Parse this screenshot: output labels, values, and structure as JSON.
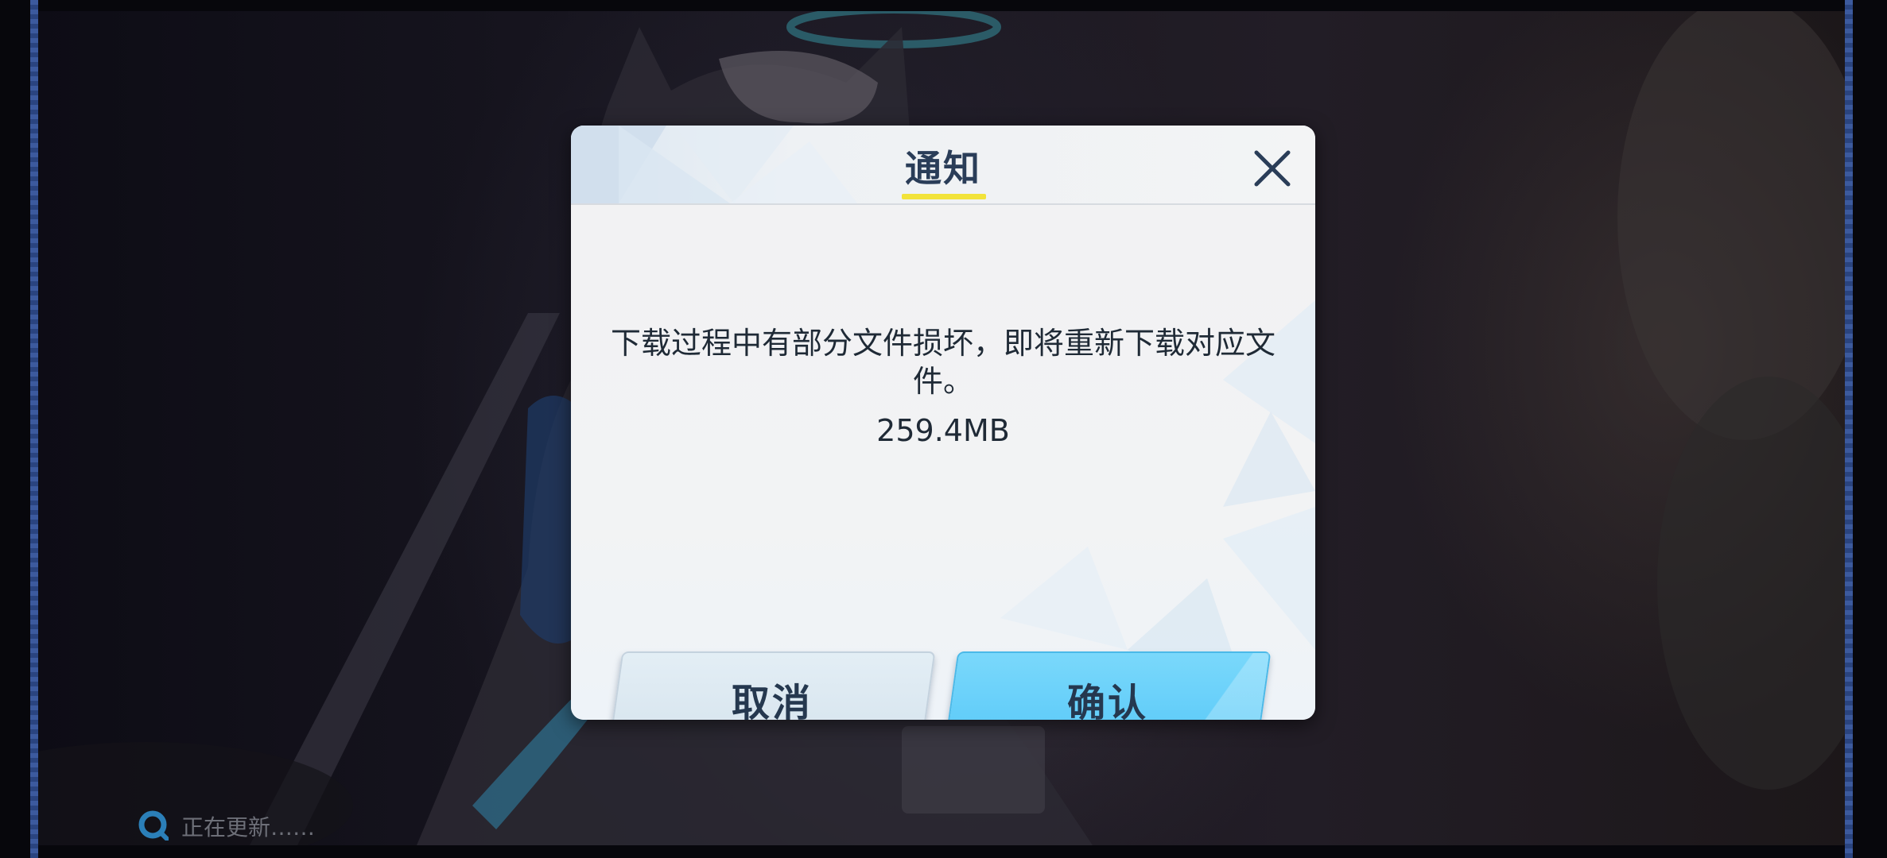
{
  "dialog": {
    "title": "通知",
    "message": "下载过程中有部分文件损坏，即将重新下载对应文件。",
    "size": "259.4MB",
    "cancel_label": "取消",
    "confirm_label": "确认"
  },
  "status": {
    "text": "正在更新……",
    "icon": "loading-icon"
  },
  "icons": {
    "close": "close-icon"
  },
  "colors": {
    "title": "#2a3d58",
    "accent_underline": "#f2e33a",
    "confirm_button": "#59c9f8",
    "cancel_button": "#d6e4ee"
  }
}
